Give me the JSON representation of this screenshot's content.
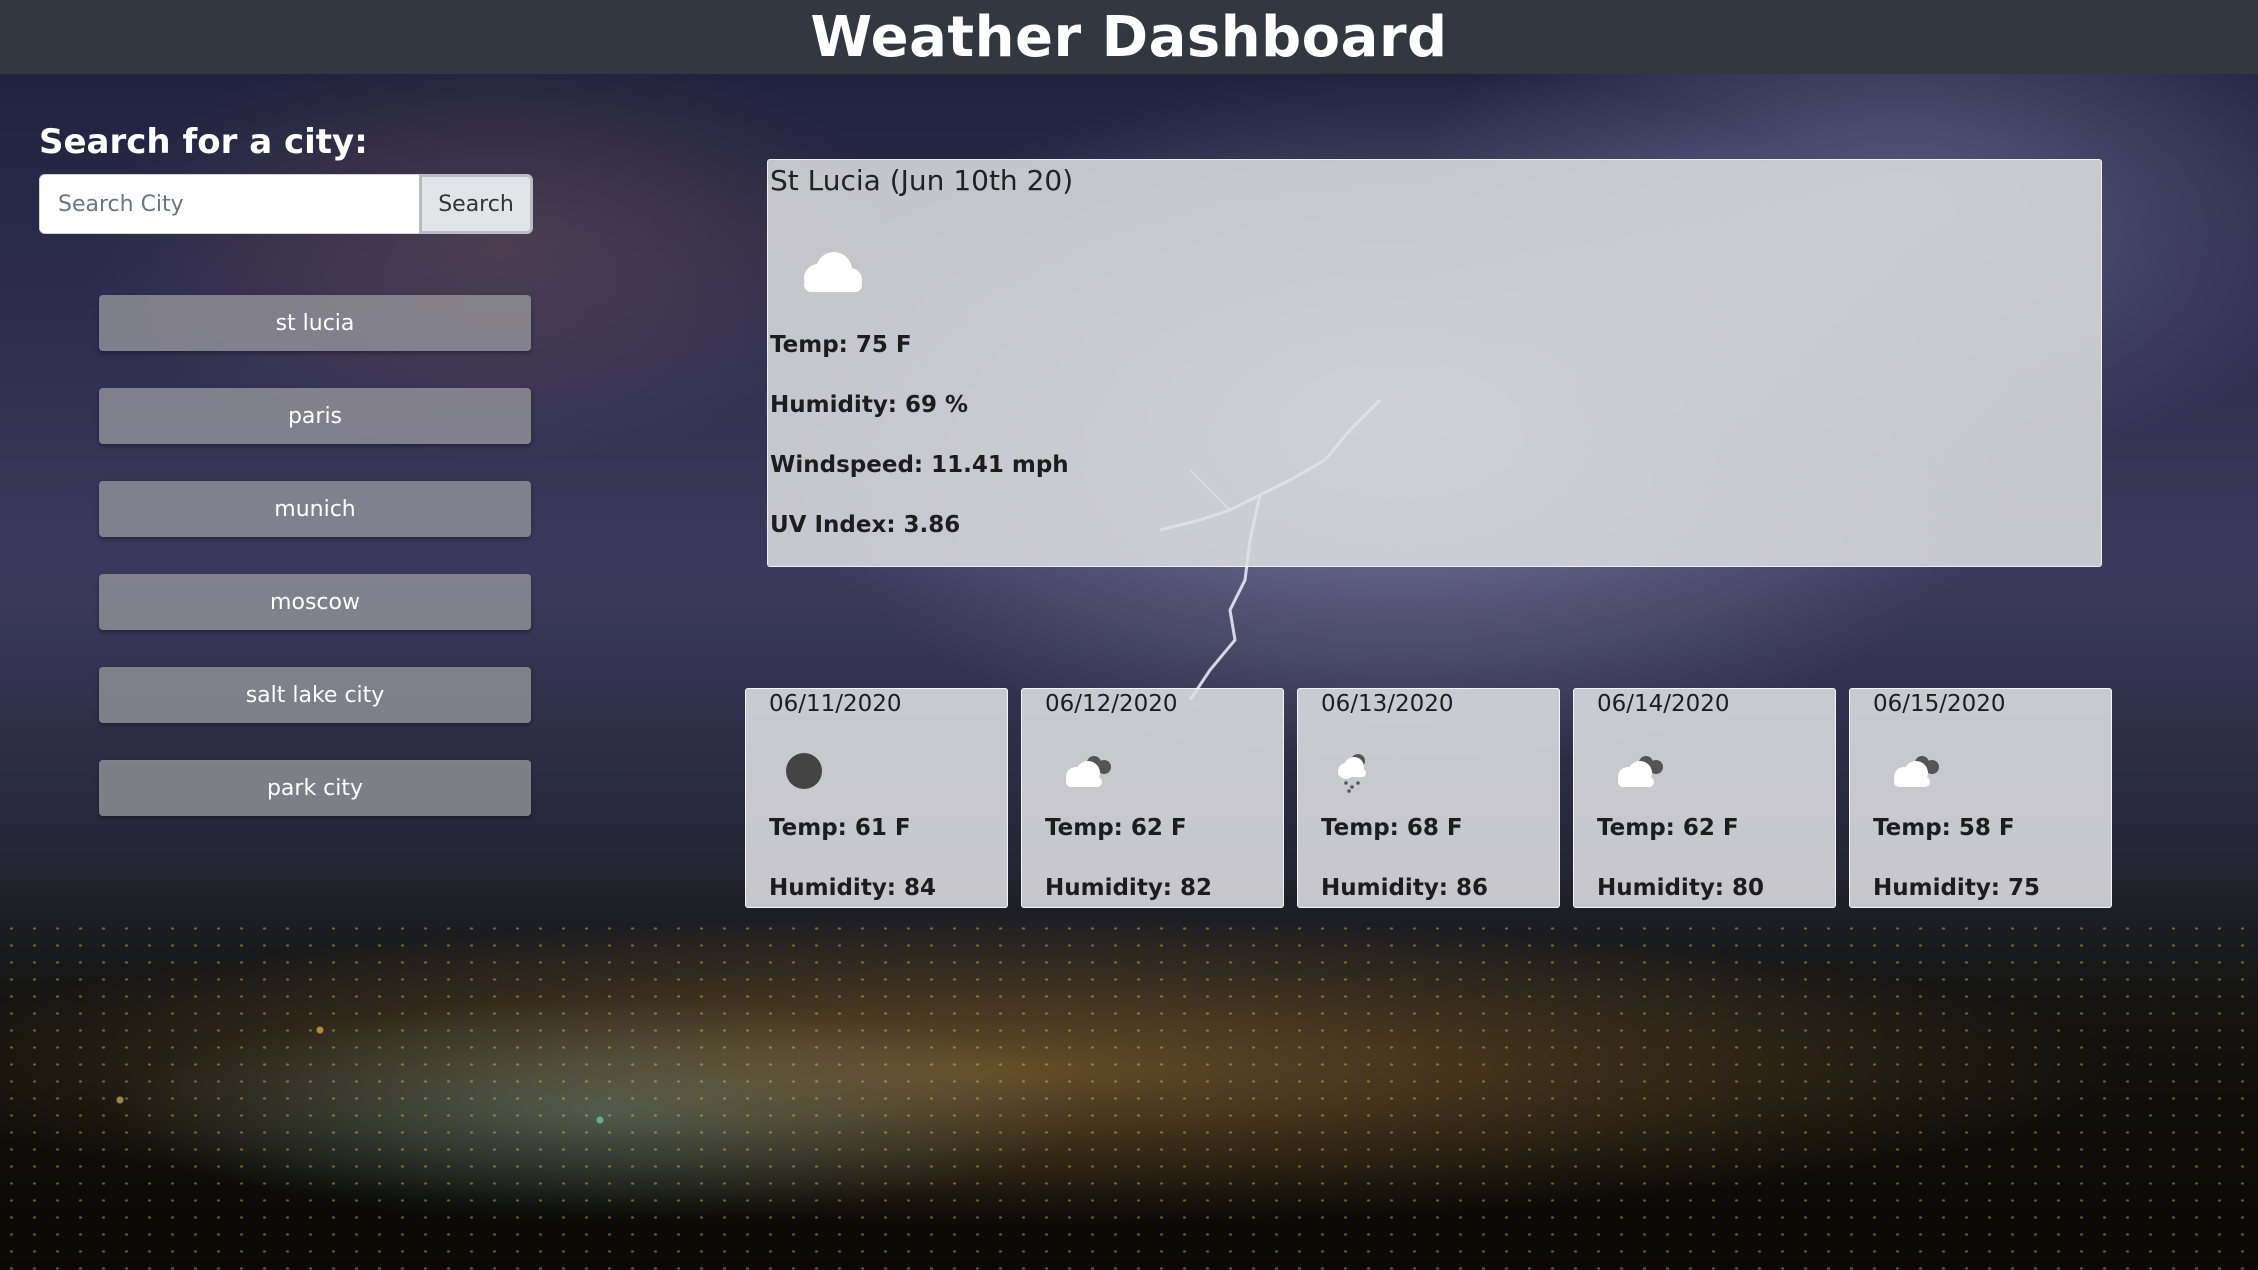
{
  "header": {
    "title": "Weather Dashboard"
  },
  "search": {
    "heading": "Search for a city:",
    "placeholder": "Search City",
    "value": "",
    "button_label": "Search"
  },
  "history": [
    "st lucia",
    "paris",
    "munich",
    "moscow",
    "salt lake city",
    "park city"
  ],
  "current": {
    "title": "St Lucia (Jun 10th 20)",
    "icon": "cloud-icon",
    "temp": "Temp: 75 F",
    "humidity": "Humidity: 69 %",
    "windspeed": "Windspeed: 11.41 mph",
    "uv_index": "UV Index: 3.86"
  },
  "forecast": [
    {
      "date": "06/11/2020",
      "icon": "dark-circle-icon",
      "temp": "Temp: 61 F",
      "humidity": "Humidity: 84"
    },
    {
      "date": "06/12/2020",
      "icon": "broken-clouds-icon",
      "temp": "Temp: 62 F",
      "humidity": "Humidity: 82"
    },
    {
      "date": "06/13/2020",
      "icon": "snow-icon",
      "temp": "Temp: 68 F",
      "humidity": "Humidity: 86"
    },
    {
      "date": "06/14/2020",
      "icon": "broken-clouds-icon",
      "temp": "Temp: 62 F",
      "humidity": "Humidity: 80"
    },
    {
      "date": "06/15/2020",
      "icon": "broken-clouds-icon",
      "temp": "Temp: 58 F",
      "humidity": "Humidity: 75"
    }
  ],
  "colors": {
    "header_bg": "#33373f",
    "card_bg": "#dedee2",
    "history_button_bg": "#96969b"
  }
}
